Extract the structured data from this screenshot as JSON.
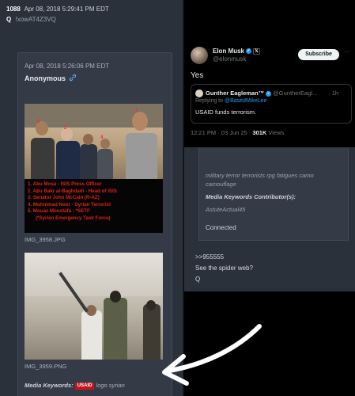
{
  "left": {
    "post_number": "1088",
    "post_timestamp": "Apr 08, 2018 5:29:41 PM EDT",
    "author": "Q",
    "tripcode": "!xowAT4Z3VQ",
    "inner_post": {
      "timestamp": "Apr 08, 2018 5:26:06 PM EDT",
      "author": "Anonymous",
      "link_icon": "link-icon",
      "image1": {
        "numbers": [
          "5",
          "2",
          "4",
          "1"
        ],
        "caption_lines": [
          "1. Abu Mosa - ISIS Press Officer",
          "2. Abu Bakr al-Baghdadi - Head of ISIS",
          "3. Senator John McCain (R-AZ)",
          "4. Muhmmad Noor - Syrian Terrorist",
          "5. Mouaz Moustafa - *SETF"
        ],
        "caption_sub": "(*Syrian Emergency Task Force)",
        "filename": "IMG_3958.JPG"
      },
      "image2": {
        "filename": "IMG_3959.PNG"
      },
      "keywords_label": "Media Keywords:",
      "keywords_badge": "USAID",
      "keywords_text": "logo syrian"
    }
  },
  "tweet": {
    "display_name": "Elon Musk",
    "handle": "@elonmusk",
    "subscribe_label": "Subscribe",
    "more_icon": "more-icon",
    "text": "Yes",
    "quote": {
      "name": "Gunther Eagleman™",
      "handle": "@GuntherEagl...",
      "time": "· 1h",
      "reply_prefix": "Replying to",
      "reply_to": "@BasedMikeLee",
      "text": "USAID funds terrorism."
    },
    "meta_time": "12:21 PM · 03 Jun 25 ·",
    "views_count": "301K",
    "views_label": "Views"
  },
  "board2": {
    "line1": "military terror terrorists rpg fatigues camo",
    "line2": "camouflage",
    "contributor_label": "Media Keywords Contributor(s):",
    "contributor": "AstuteActual45",
    "status": "Connected"
  },
  "board3": {
    "reply_ref": ">>955555",
    "question": "See the spider web?",
    "sign": "Q"
  },
  "colors": {
    "board_bg": "#2b313b",
    "post_bg": "#343b47",
    "x_bg": "#000000",
    "caption_red": "#e61e1e",
    "verified_blue": "#1d9bf0"
  }
}
